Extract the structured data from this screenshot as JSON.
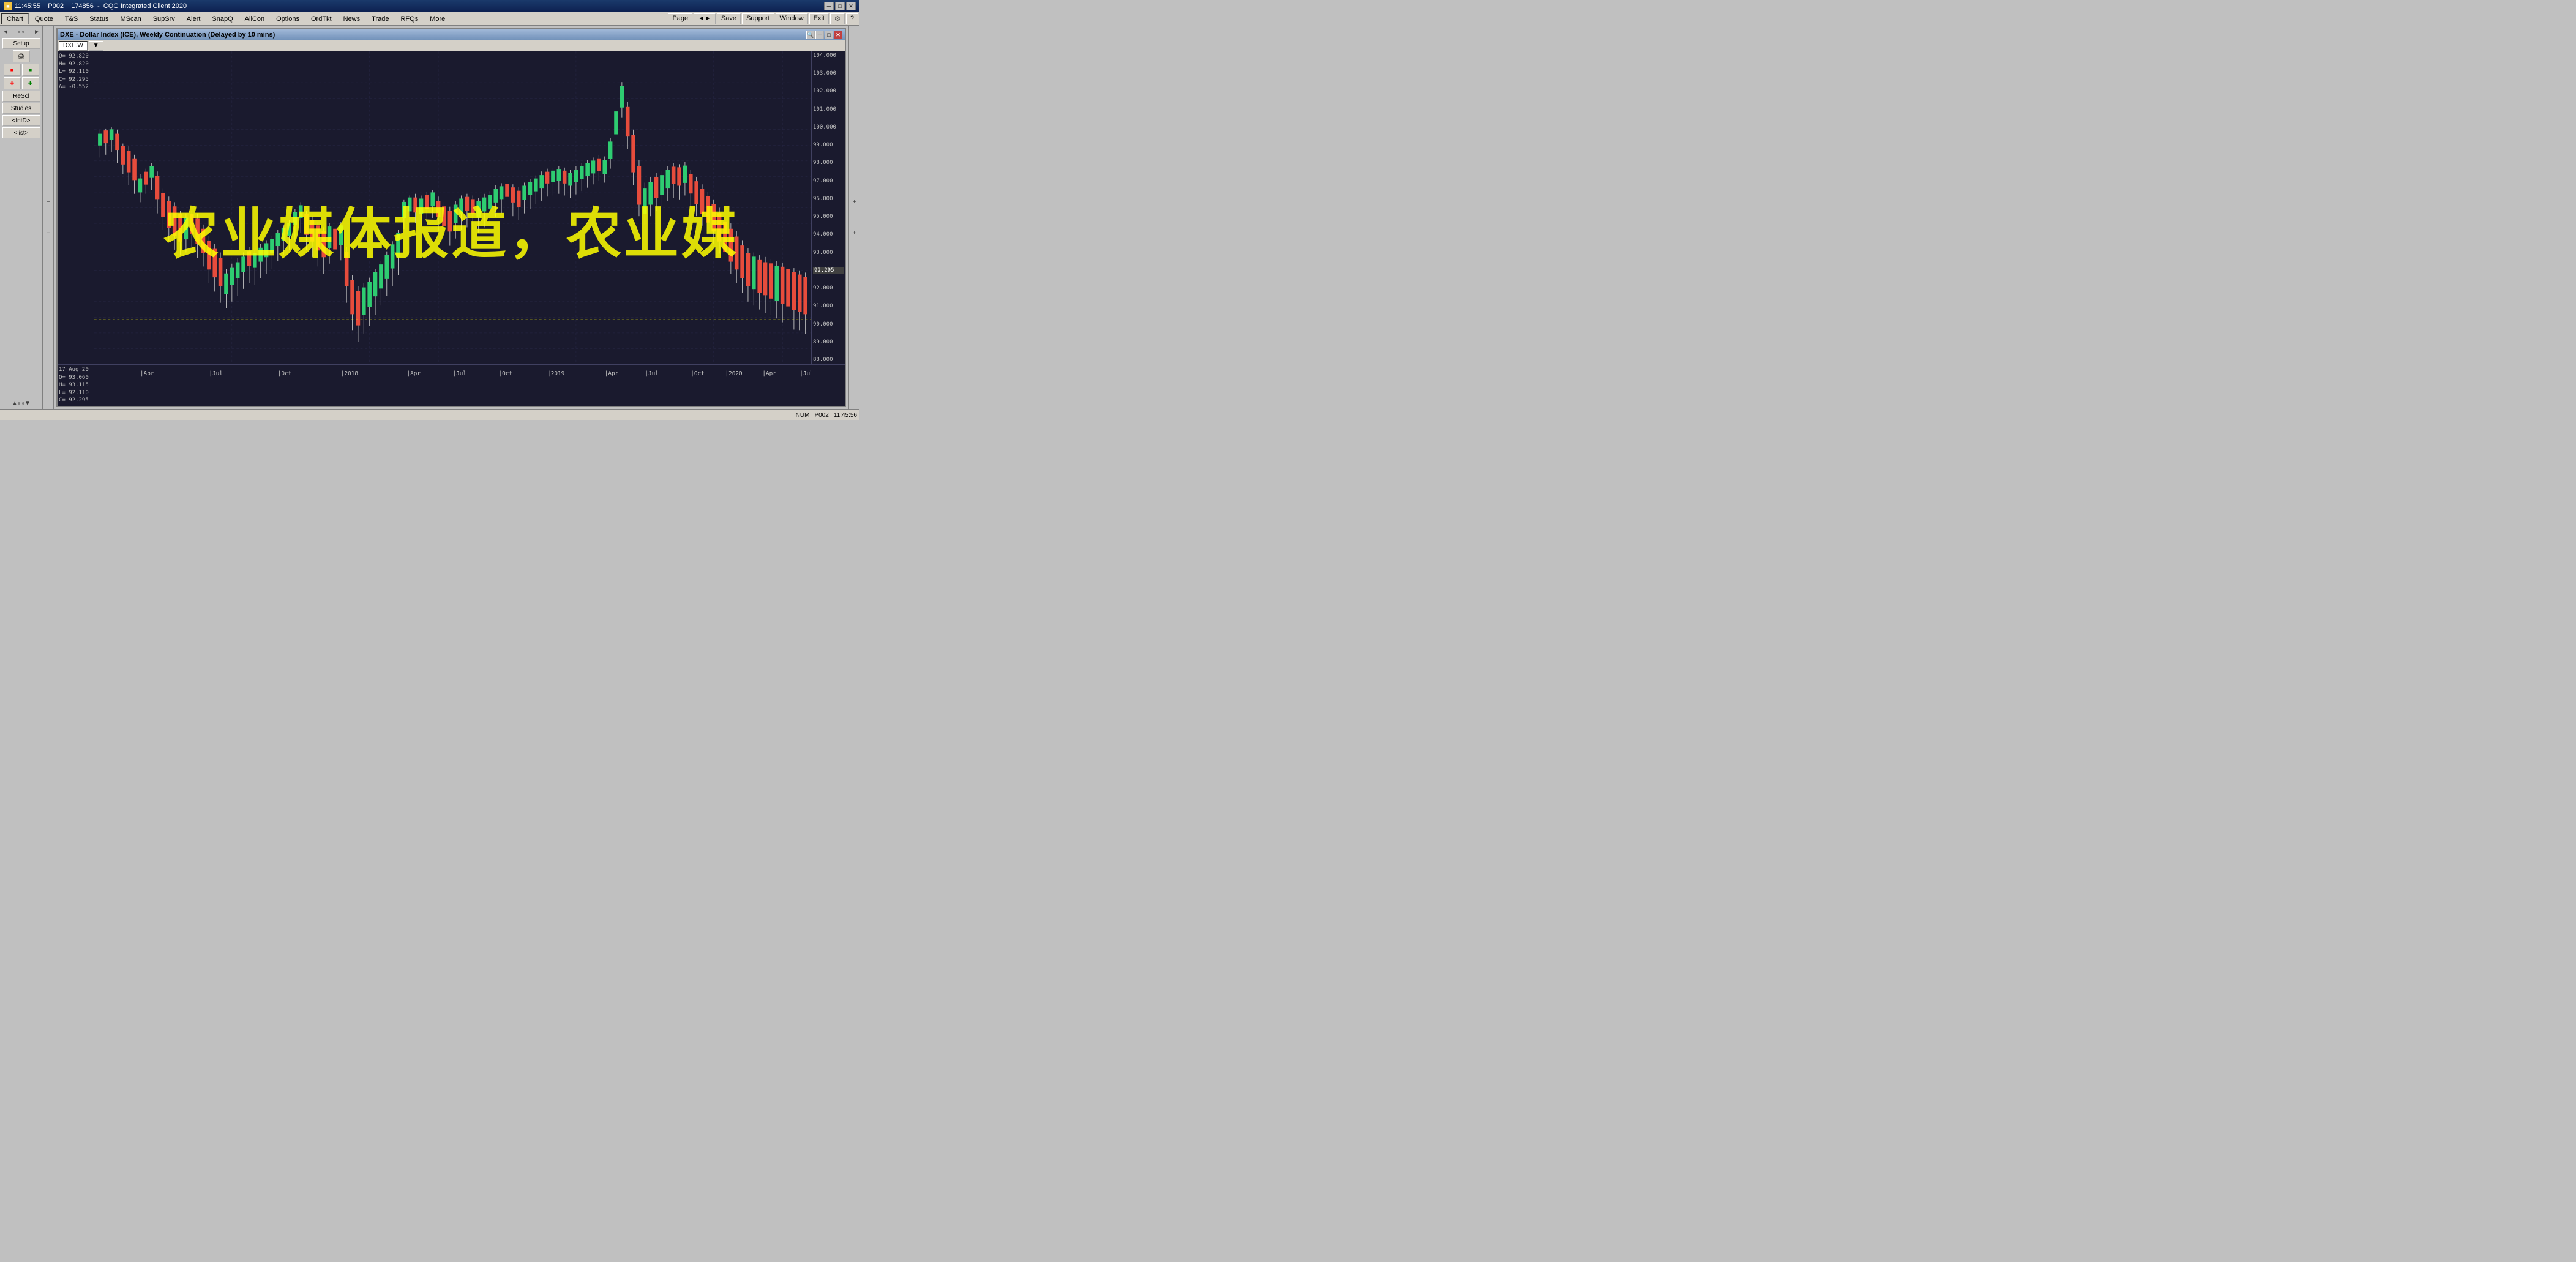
{
  "titlebar": {
    "time": "11:45:55",
    "account": "P002",
    "id": "174856",
    "app": "CQG Integrated Client 2020",
    "minimize": "─",
    "maximize": "□",
    "close": "✕"
  },
  "menubar": {
    "items": [
      {
        "label": "Chart",
        "active": true
      },
      {
        "label": "Quote",
        "active": false
      },
      {
        "label": "T&S",
        "active": false
      },
      {
        "label": "Status",
        "active": false
      },
      {
        "label": "MScan",
        "active": false
      },
      {
        "label": "SupSrv",
        "active": false
      },
      {
        "label": "Alert",
        "active": false
      },
      {
        "label": "SnapQ",
        "active": false
      },
      {
        "label": "AllCon",
        "active": false
      },
      {
        "label": "Options",
        "active": false
      },
      {
        "label": "OrdTkt",
        "active": false
      },
      {
        "label": "News",
        "active": false
      },
      {
        "label": "Trade",
        "active": false
      },
      {
        "label": "RFQs",
        "active": false
      },
      {
        "label": "More",
        "active": false
      }
    ],
    "right": {
      "page": "Page",
      "arrows": "◄►",
      "save": "Save",
      "support": "Support",
      "window": "Window",
      "exit": "Exit",
      "settings": "⚙",
      "help": "?"
    }
  },
  "sidebar": {
    "setup": "Setup",
    "rescl": "ReScl",
    "studies": "Studies",
    "intd": "<IntD>",
    "list": "<list>"
  },
  "chart_window": {
    "title": "DXE - Dollar Index (ICE), Weekly Continuation (Delayed by 10 mins)",
    "tab1": "DXE.W",
    "tab2": "▼",
    "ohlc": {
      "open": "O=  92.820",
      "high": "H=  92.820",
      "low": "L=  92.110",
      "close": "C=  92.295",
      "delta": "Δ=  -0.552"
    },
    "bottom_ohlc": {
      "date": "17 Aug 20",
      "open": "O=  93.060",
      "high": "H=  93.115",
      "low": "L=  92.110",
      "close": "C=  92.295"
    },
    "price_labels": [
      "104.000",
      "103.000",
      "102.000",
      "101.000",
      "100.000",
      "99.000",
      "98.000",
      "97.000",
      "96.000",
      "95.000",
      "94.000",
      "93.000",
      "92.295",
      "92.000",
      "91.000",
      "90.000",
      "89.000",
      "88.000"
    ],
    "current_price": "92.295",
    "date_labels": [
      "Apr",
      "Jul",
      "Oct",
      "2018",
      "Apr",
      "Jul",
      "Oct",
      "2019",
      "Apr",
      "Jul",
      "Oct",
      "2020",
      "Apr",
      "Jul"
    ],
    "watermark": "农业媒体报道，农业媒"
  },
  "statusbar": {
    "num": "NUM",
    "account": "P002",
    "time": "11:45:56"
  }
}
